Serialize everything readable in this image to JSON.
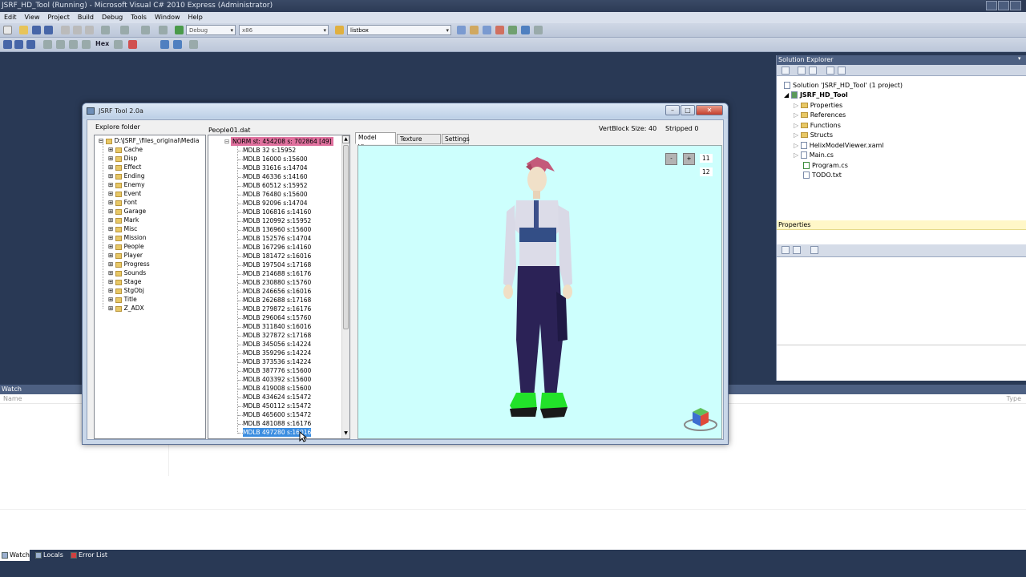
{
  "vs": {
    "title": "JSRF_HD_Tool (Running) - Microsoft Visual C# 2010 Express (Administrator)",
    "menu": [
      "Edit",
      "View",
      "Project",
      "Build",
      "Debug",
      "Tools",
      "Window",
      "Help"
    ],
    "toolbar": {
      "config": "Debug",
      "platform": "x86",
      "find_combo": "listbox",
      "hex_label": "Hex"
    },
    "solution_explorer": {
      "header": "Solution Explorer",
      "solution": "Solution 'JSRF_HD_Tool' (1 project)",
      "project": "JSRF_HD_Tool",
      "items": [
        "Properties",
        "References",
        "Functions",
        "Structs",
        "HelixModelViewer.xaml",
        "Main.cs",
        "Program.cs",
        "TODO.txt"
      ]
    },
    "properties": {
      "header": "Properties"
    },
    "watch": {
      "header": "Watch",
      "col_name": "Name",
      "col_type": "Type"
    },
    "bottom_tabs": [
      "Watch",
      "Locals",
      "Error List"
    ]
  },
  "tool": {
    "title": "JSRF Tool 2.0a",
    "explore_label": "Explore folder",
    "root_path": "D:\\JSRF_\\files_original\\Media",
    "folders": [
      "Cache",
      "Disp",
      "Effect",
      "Ending",
      "Enemy",
      "Event",
      "Font",
      "Garage",
      "Mark",
      "Misc",
      "Mission",
      "People",
      "Player",
      "Progress",
      "Sounds",
      "Stage",
      "StgObj",
      "Title",
      "Z_ADX"
    ],
    "file_label": "People01.dat",
    "vertblock": "VertBlock Size: 40",
    "stripped": "Stripped 0",
    "norm_item": "NORM st: 454208 s: 702864 [49]",
    "mdlb_items": [
      "MDLB 32 s:15952",
      "MDLB 16000 s:15600",
      "MDLB 31616 s:14704",
      "MDLB 46336 s:14160",
      "MDLB 60512 s:15952",
      "MDLB 76480 s:15600",
      "MDLB 92096 s:14704",
      "MDLB 106816 s:14160",
      "MDLB 120992 s:15952",
      "MDLB 136960 s:15600",
      "MDLB 152576 s:14704",
      "MDLB 167296 s:14160",
      "MDLB 181472 s:16016",
      "MDLB 197504 s:17168",
      "MDLB 214688 s:16176",
      "MDLB 230880 s:15760",
      "MDLB 246656 s:16016",
      "MDLB 262688 s:17168",
      "MDLB 279872 s:16176",
      "MDLB 296064 s:15760",
      "MDLB 311840 s:16016",
      "MDLB 327872 s:17168",
      "MDLB 345056 s:14224",
      "MDLB 359296 s:14224",
      "MDLB 373536 s:14224",
      "MDLB 387776 s:15600",
      "MDLB 403392 s:15600",
      "MDLB 419008 s:15600",
      "MDLB 434624 s:15472",
      "MDLB 450112 s:15472",
      "MDLB 465600 s:15472",
      "MDLB 481088 s:16176"
    ],
    "selected_item": "MDLB 497280 s:16016",
    "tabs": [
      "Model Viewer",
      "Texture Viewer",
      "Settings"
    ],
    "viewer": {
      "minus": "-",
      "plus": "+",
      "num1": "11",
      "num2": "12",
      "bg_color": "#cdfffd"
    }
  }
}
